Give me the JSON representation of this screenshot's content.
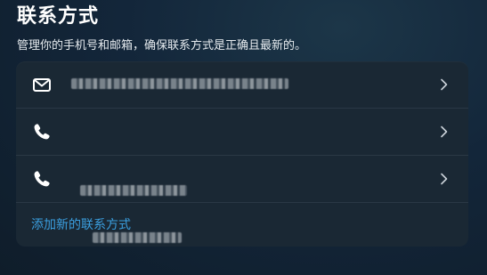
{
  "header": {
    "title": "联系方式",
    "subtitle": "管理你的手机号和邮箱，确保联系方式是正确且最新的。"
  },
  "contacts": [
    {
      "type": "email",
      "icon": "envelope-icon",
      "value_masked": true
    },
    {
      "type": "phone",
      "icon": "phone-icon",
      "value_masked": true
    },
    {
      "type": "phone",
      "icon": "phone-icon",
      "value_masked": true
    }
  ],
  "actions": {
    "add_contact_label": "添加新的联系方式"
  },
  "colors": {
    "accent_link": "#3b9fe0",
    "card_background": "#1a2834",
    "divider": "#2a3845"
  }
}
